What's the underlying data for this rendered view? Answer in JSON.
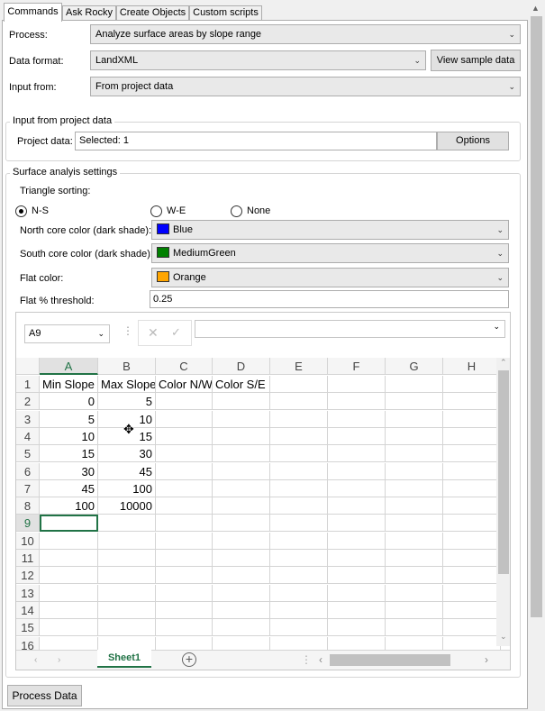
{
  "tabs": [
    "Commands",
    "Ask Rocky",
    "Create Objects",
    "Custom scripts"
  ],
  "process": {
    "label": "Process:",
    "value": "Analyze surface areas by slope range"
  },
  "data_format": {
    "label": "Data format:",
    "value": "LandXML",
    "button": "View sample data"
  },
  "input_from": {
    "label": "Input from:",
    "value": "From project data"
  },
  "input_group": {
    "title": "Input from project data",
    "label": "Project data:",
    "value": "Selected: 1",
    "button": "Options"
  },
  "surface_group": {
    "title": "Surface analyis settings",
    "triangle_sorting": "Triangle sorting:",
    "options": [
      "N-S",
      "W-E",
      "None"
    ],
    "selected_option": "N-S",
    "north_label": "North core color (dark shade):",
    "north_value": "Blue",
    "north_color": "#0000ff",
    "south_label": "South core color (dark shade):",
    "south_value": "MediumGreen",
    "south_color": "#008000",
    "flat_label": "Flat color:",
    "flat_value": "Orange",
    "flat_color": "#ffa500",
    "threshold_label": "Flat % threshold:",
    "threshold_value": "0.25"
  },
  "sheet": {
    "name_box": "A9",
    "columns": [
      "A",
      "B",
      "C",
      "D",
      "E",
      "F",
      "G",
      "H"
    ],
    "rows": [
      [
        "Min Slope",
        "Max Slope",
        "Color N/W",
        "Color S/E"
      ],
      [
        "0",
        "5"
      ],
      [
        "5",
        "10"
      ],
      [
        "10",
        "15"
      ],
      [
        "15",
        "30"
      ],
      [
        "30",
        "45"
      ],
      [
        "45",
        "100"
      ],
      [
        "100",
        "10000"
      ]
    ],
    "row_numbers": [
      "1",
      "2",
      "3",
      "4",
      "5",
      "6",
      "7",
      "8",
      "9",
      "10",
      "11",
      "12",
      "13",
      "14",
      "15",
      "16"
    ],
    "tab": "Sheet1"
  },
  "process_button": "Process Data"
}
